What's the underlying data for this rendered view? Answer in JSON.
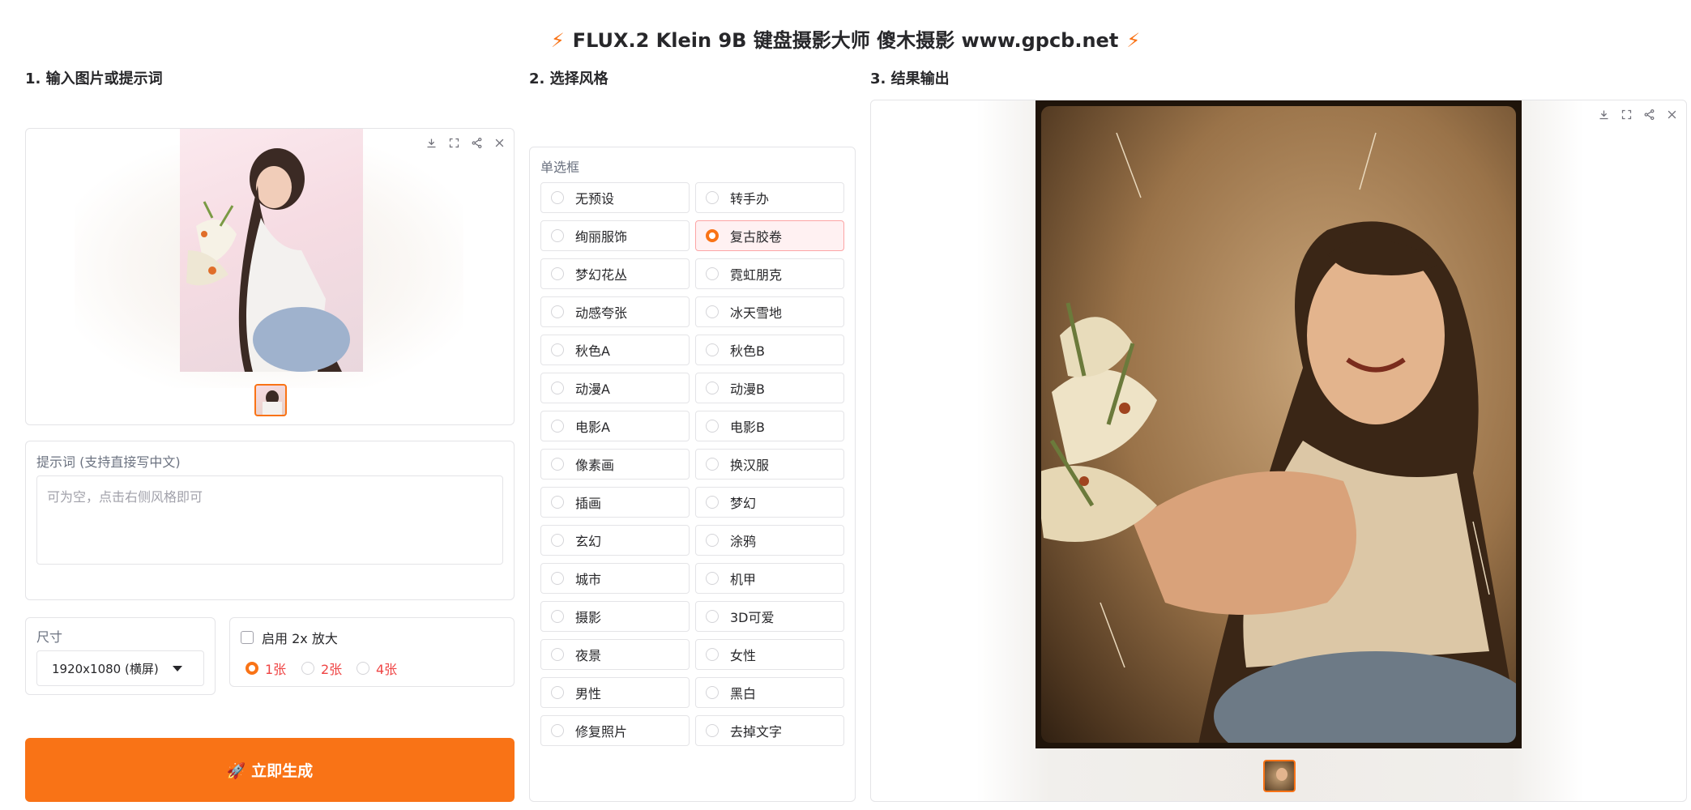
{
  "header": {
    "title": "FLUX.2 Klein 9B 键盘摄影大师 傻木摄影 www.gpcb.net"
  },
  "sections": {
    "input": "1. 输入图片或提示词",
    "style": "2. 选择风格",
    "output": "3. 结果输出"
  },
  "icons": [
    "bolt-icon",
    "download-icon",
    "fullscreen-icon",
    "share-icon",
    "close-icon",
    "rocket-icon"
  ],
  "prompt": {
    "label": "提示词 (支持直接写中文)",
    "placeholder": "可为空，点击右侧风格即可"
  },
  "size": {
    "label": "尺寸",
    "value": "1920x1080 (横屏)"
  },
  "upscale": {
    "label": "启用 2x 放大"
  },
  "count": {
    "options": [
      "1张",
      "2张",
      "4张"
    ],
    "selected": "1张"
  },
  "generate_label": "🚀 立即生成",
  "style_group": {
    "label": "单选框",
    "selected": "复古胶卷",
    "options": [
      "无预设",
      "转手办",
      "绚丽服饰",
      "复古胶卷",
      "梦幻花丛",
      "霓虹朋克",
      "动感夸张",
      "冰天雪地",
      "秋色A",
      "秋色B",
      "动漫A",
      "动漫B",
      "电影A",
      "电影B",
      "像素画",
      "换汉服",
      "插画",
      "梦幻",
      "玄幻",
      "涂鸦",
      "城市",
      "机甲",
      "摄影",
      "3D可爱",
      "夜景",
      "女性",
      "男性",
      "黑白",
      "修复照片",
      "去掉文字"
    ]
  },
  "colors": {
    "accent": "#f97316",
    "count_text": "#ef4444"
  }
}
